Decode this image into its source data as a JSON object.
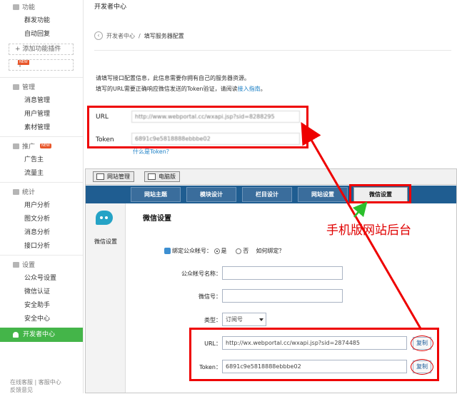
{
  "sidebar": {
    "function": {
      "head": "功能",
      "items": [
        "群发功能",
        "自动回复"
      ],
      "add_plugin": "添加功能插件",
      "add": "+"
    },
    "manage": {
      "head": "管理",
      "items": [
        "消息管理",
        "用户管理",
        "素材管理"
      ]
    },
    "promote": {
      "head": "推广",
      "items": [
        "广告主",
        "流量主"
      ]
    },
    "stats": {
      "head": "统计",
      "items": [
        "用户分析",
        "图文分析",
        "消息分析",
        "接口分析"
      ]
    },
    "settings": {
      "head": "设置",
      "items": [
        "公众号设置",
        "微信认证",
        "安全助手",
        "安全中心"
      ]
    },
    "dev_center": "开发者中心",
    "footer": [
      "在线客服 | 客服中心",
      "反馈意见"
    ],
    "hot": "NEW"
  },
  "main": {
    "page_title": "开发者中心",
    "breadcrumb": [
      "开发者中心",
      "/",
      "填写服务器配置"
    ],
    "desc1": "请填写接口配置信息，此信息需要你拥有自己的服务器资源。",
    "desc2_prefix": "填写的URL需要正确响应微信发送的Token验证，请阅读",
    "desc2_link": "接入指南",
    "desc2_suffix": "。",
    "url_label": "URL",
    "url_value": "http://www.webportal.cc/wxapi.jsp?sid=8288295",
    "token_label": "Token",
    "token_value": "6891c9e5818888ebbbe02",
    "help_link": "什么是Token？"
  },
  "panel": {
    "tab_site": "网站管理",
    "tab_pc": "电脑版",
    "nav": [
      "网站主题",
      "模块设计",
      "栏目设计",
      "网站设置",
      "微信设置"
    ],
    "left_label": "微信设置",
    "title": "微信设置",
    "bind_label": "绑定公众帐号：",
    "yes": "是",
    "no": "否",
    "how_bind": "如何绑定？",
    "account_name_label": "公众帐号名称：",
    "wechat_id_label": "微信号：",
    "type_label": "类型：",
    "type_value": "订阅号",
    "url_label": "URL：",
    "url_value": "http://wx.webportal.cc/wxapi.jsp?sid=2874485",
    "token_label": "Token：",
    "token_value": "6891c9e5818888ebbbe02",
    "copy": "复制"
  },
  "annotation": "手机版网站后台",
  "colors": {
    "accent_green": "#44b549",
    "nav_blue": "#1f5d91",
    "annotation_red": "#e00000"
  }
}
